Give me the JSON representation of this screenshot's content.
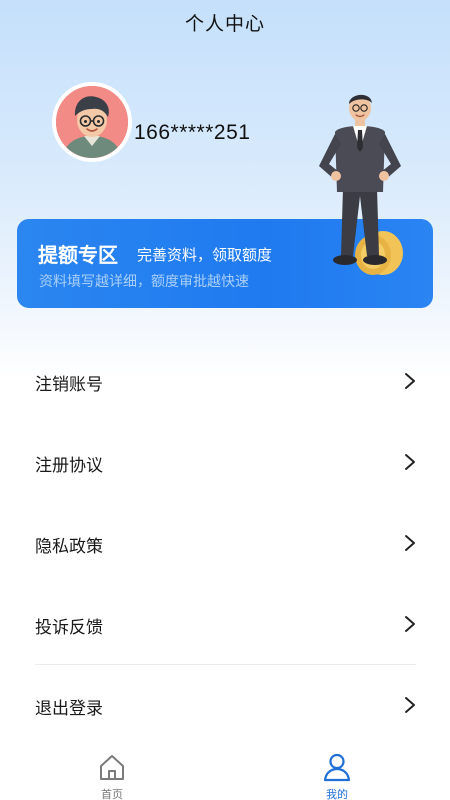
{
  "header": {
    "title": "个人中心"
  },
  "profile": {
    "phone": "166*****251"
  },
  "banner": {
    "title": "提额专区",
    "subtitle": "完善资料，领取额度",
    "description": "资料填写越详细，额度审批越快速"
  },
  "menu": {
    "items": [
      {
        "label": "注销账号"
      },
      {
        "label": "注册协议"
      },
      {
        "label": "隐私政策"
      },
      {
        "label": "投诉反馈"
      },
      {
        "label": "退出登录"
      }
    ]
  },
  "tabbar": {
    "home_label": "首页",
    "mine_label": "我的",
    "active_tab": "我的",
    "active_color": "#1f6fd8"
  },
  "colors": {
    "banner_blue": "#2b86f0",
    "header_gradient_top": "#c5e0fb"
  }
}
